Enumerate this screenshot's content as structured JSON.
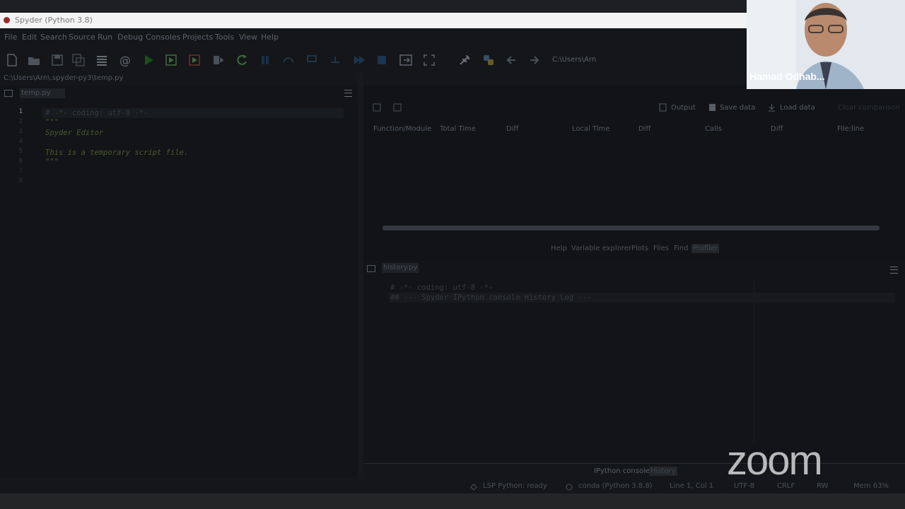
{
  "window": {
    "title": "Spyder (Python 3.8)"
  },
  "menu": [
    "File",
    "Edit",
    "Search",
    "Source",
    "Run",
    "Debug",
    "Consoles",
    "Projects",
    "Tools",
    "View",
    "Help"
  ],
  "toolbar": {
    "cwd": "C:\\Users\\Arn"
  },
  "editor": {
    "filepath": "C:\\Users\\Arn\\.spyder-py3\\temp.py",
    "tab": "temp.py",
    "line_numbers": [
      "1",
      "2",
      "3",
      "4",
      "5",
      "6",
      "7",
      "8"
    ],
    "lines": [
      "# -*- coding: utf-8 -*-",
      "\"\"\"",
      "Spyder Editor",
      "",
      "This is a temporary script file.",
      "\"\"\"",
      "",
      ""
    ]
  },
  "profiler": {
    "actions": {
      "output": "Output",
      "save": "Save data",
      "load": "Load data",
      "clear": "Clear comparison"
    },
    "columns": [
      "Function/Module",
      "Total Time",
      "Diff",
      "Local Time",
      "Diff",
      "Calls",
      "Diff",
      "File:line"
    ],
    "tabs": [
      "Help",
      "Variable explorer",
      "Plots",
      "Files",
      "Find",
      "Profiler"
    ],
    "active_tab": "Profiler"
  },
  "history": {
    "tab": "history.py",
    "lines": [
      "# -*- coding: utf-8 -*-",
      "## --- Spyder IPython console History Log ---"
    ]
  },
  "bottom_tabs": [
    "IPython console",
    "History"
  ],
  "status": {
    "lsp": "LSP Python: ready",
    "env": "conda (Python 3.8.8)",
    "pos": "Line 1, Col 1",
    "enc": "UTF-8",
    "eol": "CRLF",
    "rw": "RW",
    "mem": "Mem 63%"
  },
  "overlay": {
    "participant": "Hamad Odhab...",
    "logo": "zoom"
  }
}
